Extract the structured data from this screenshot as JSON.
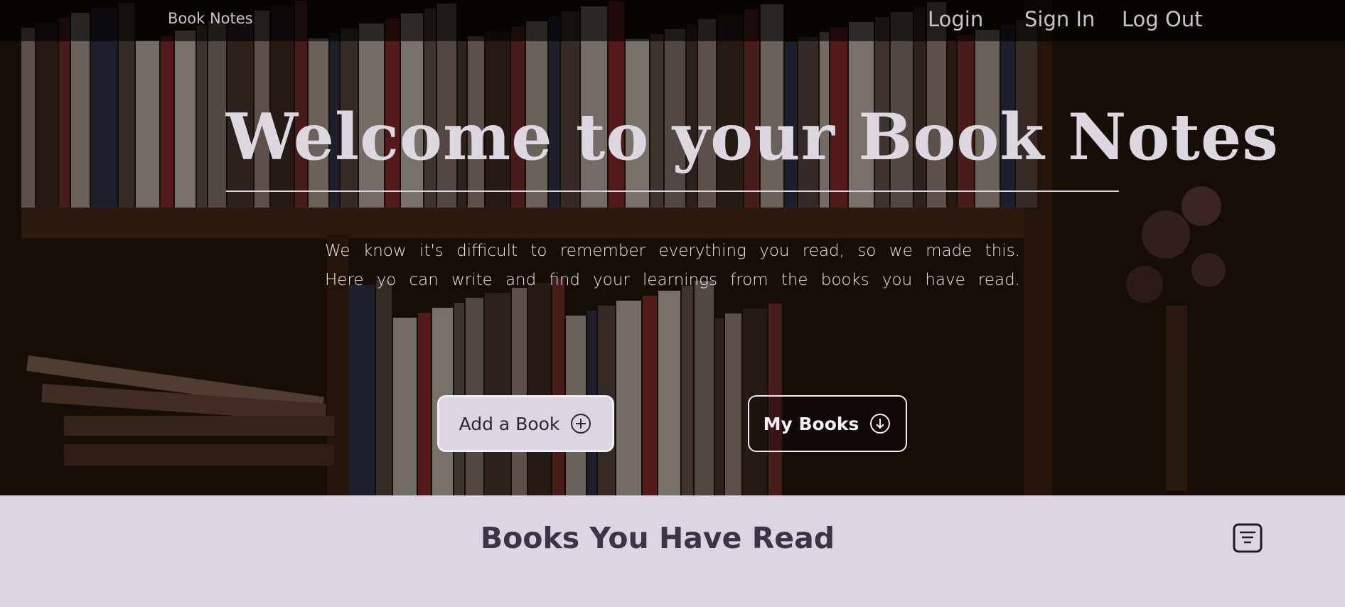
{
  "navbar": {
    "brand": "Book Notes",
    "links": [
      "Login",
      "Sign In",
      "Log Out"
    ]
  },
  "hero": {
    "headline": "Welcome to your Book Notes",
    "tagline_lines": [
      "We know it's difficult to remember everything you read, so we made this.",
      "Here yo can write and find your learnings from the books you have read."
    ],
    "buttons": {
      "add_label": "Add a Book",
      "add_icon": "plus-circle-icon",
      "my_label": "My Books",
      "my_icon": "arrow-down-circle-icon"
    }
  },
  "section": {
    "title": "Books You Have Read",
    "filter_icon": "filter-icon"
  },
  "colors": {
    "navbar_bg": "#0b0807",
    "headline": "#ddd7e2",
    "section_bg": "#dcd6e2",
    "section_title": "#3b3548"
  }
}
